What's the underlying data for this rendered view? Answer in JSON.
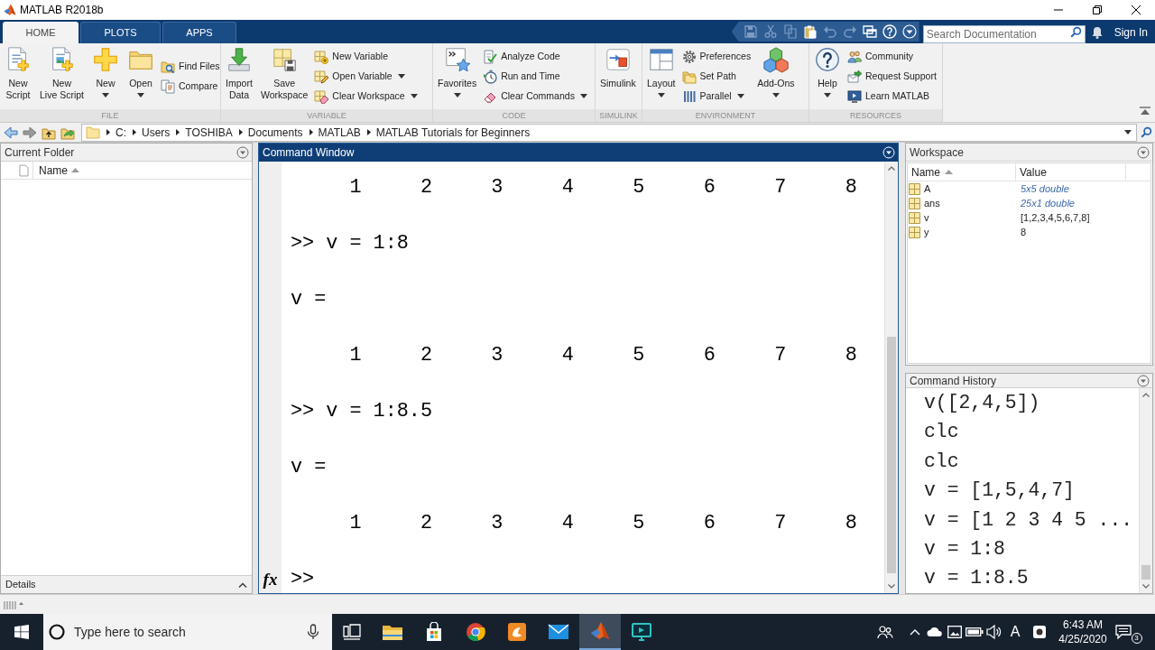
{
  "window": {
    "title": "MATLAB R2018b"
  },
  "tabs": [
    {
      "label": "HOME",
      "selected": true
    },
    {
      "label": "PLOTS",
      "selected": false
    },
    {
      "label": "APPS",
      "selected": false
    }
  ],
  "quick_access": [
    {
      "disabled": true
    },
    {
      "disabled": true
    },
    {
      "disabled": true
    },
    {
      "disabled": false
    },
    {
      "disabled": true
    },
    {
      "disabled": true
    },
    {
      "disabled": false
    },
    {
      "disabled": false
    },
    {
      "disabled": false
    }
  ],
  "search": {
    "placeholder": "Search Documentation"
  },
  "sign_in": "Sign In",
  "toolstrip": [
    {
      "label": "FILE",
      "groups": [
        {
          "kind": "large",
          "lines": [
            "New",
            "Script"
          ],
          "menu": false
        },
        {
          "kind": "large",
          "lines": [
            "New",
            "Live Script"
          ],
          "menu": false
        },
        {
          "kind": "large",
          "lines": [
            "New"
          ],
          "menu": true
        },
        {
          "kind": "large",
          "lines": [
            "Open"
          ],
          "menu": true
        },
        {
          "kind": "stack",
          "items": [
            {
              "label": "Find Files",
              "menu": false
            },
            {
              "label": "Compare",
              "menu": false
            }
          ]
        }
      ]
    },
    {
      "label": "VARIABLE",
      "groups": [
        {
          "kind": "large",
          "lines": [
            "Import",
            "Data"
          ],
          "menu": false
        },
        {
          "kind": "large",
          "lines": [
            "Save",
            "Workspace"
          ],
          "menu": false
        },
        {
          "kind": "stack",
          "items": [
            {
              "label": "New Variable",
              "menu": false
            },
            {
              "label": "Open Variable",
              "menu": true
            },
            {
              "label": "Clear Workspace",
              "menu": true
            }
          ]
        }
      ]
    },
    {
      "label": "CODE",
      "groups": [
        {
          "kind": "large",
          "lines": [
            "Favorites"
          ],
          "menu": true
        },
        {
          "kind": "stack",
          "items": [
            {
              "label": "Analyze Code",
              "menu": false
            },
            {
              "label": "Run and Time",
              "menu": false
            },
            {
              "label": "Clear Commands",
              "menu": true
            }
          ]
        }
      ]
    },
    {
      "label": "SIMULINK",
      "groups": [
        {
          "kind": "large",
          "lines": [
            "Simulink"
          ],
          "menu": false
        }
      ]
    },
    {
      "label": "ENVIRONMENT",
      "groups": [
        {
          "kind": "large",
          "lines": [
            "Layout"
          ],
          "menu": true
        },
        {
          "kind": "stack",
          "items": [
            {
              "label": "Preferences",
              "menu": false
            },
            {
              "label": "Set Path",
              "menu": false
            },
            {
              "label": "Parallel",
              "menu": true
            }
          ]
        },
        {
          "kind": "large",
          "lines": [
            "Add-Ons"
          ],
          "menu": true
        }
      ]
    },
    {
      "label": "RESOURCES",
      "groups": [
        {
          "kind": "large",
          "lines": [
            "Help"
          ],
          "menu": true
        },
        {
          "kind": "stack",
          "items": [
            {
              "label": "Community",
              "menu": false
            },
            {
              "label": "Request Support",
              "menu": false
            },
            {
              "label": "Learn MATLAB",
              "menu": false
            }
          ]
        }
      ]
    }
  ],
  "address_bar": {
    "path": [
      "C:",
      "Users",
      "TOSHIBA",
      "Documents",
      "MATLAB",
      "MATLAB Tutorials for Beginners"
    ]
  },
  "current_folder": {
    "title": "Current Folder",
    "column": {
      "label": "Name",
      "sorted": true
    },
    "details": "Details"
  },
  "command_window": {
    "title": "Command Window",
    "lines": [
      {
        "kind": "row",
        "values": [
          "1",
          "2",
          "3",
          "4",
          "5",
          "6",
          "7",
          "8"
        ]
      },
      {
        "kind": "line",
        "text": ">> v = 1:8"
      },
      {
        "kind": "line",
        "text": "v ="
      },
      {
        "kind": "row",
        "values": [
          "1",
          "2",
          "3",
          "4",
          "5",
          "6",
          "7",
          "8"
        ]
      },
      {
        "kind": "line",
        "text": ">> v = 1:8.5"
      },
      {
        "kind": "line",
        "text": "v ="
      },
      {
        "kind": "row",
        "values": [
          "1",
          "2",
          "3",
          "4",
          "5",
          "6",
          "7",
          "8"
        ]
      }
    ],
    "function_button": "fx",
    "prompt": ">>"
  },
  "workspace": {
    "title": "Workspace",
    "columns": [
      {
        "label": "Name",
        "sorted": true
      },
      {
        "label": "Value",
        "sorted": false
      }
    ],
    "rows": [
      {
        "name": "A",
        "value": "5x5 double",
        "kind": "summary"
      },
      {
        "name": "ans",
        "value": "25x1 double",
        "kind": "summary"
      },
      {
        "name": "v",
        "value": "[1,2,3,4,5,6,7,8]",
        "kind": "literal"
      },
      {
        "name": "y",
        "value": "8",
        "kind": "literal"
      }
    ]
  },
  "command_history": {
    "title": "Command History",
    "entries": [
      "v([2,4,5])",
      "clc",
      "clc",
      "v = [1,5,4,7]",
      "v = [1 2 3 4 5 ...",
      "v = 1:8",
      "v = 1:8.5"
    ]
  },
  "taskbar": {
    "search_placeholder": "Type here to search",
    "apps": [
      {
        "selected": false
      },
      {
        "selected": false
      },
      {
        "selected": false
      },
      {
        "selected": false
      },
      {
        "selected": false
      },
      {
        "selected": true
      },
      {
        "selected": false
      }
    ],
    "input_indicator": "A",
    "time": "6:43 AM",
    "date": "4/25/2020",
    "notification_count": "3"
  }
}
